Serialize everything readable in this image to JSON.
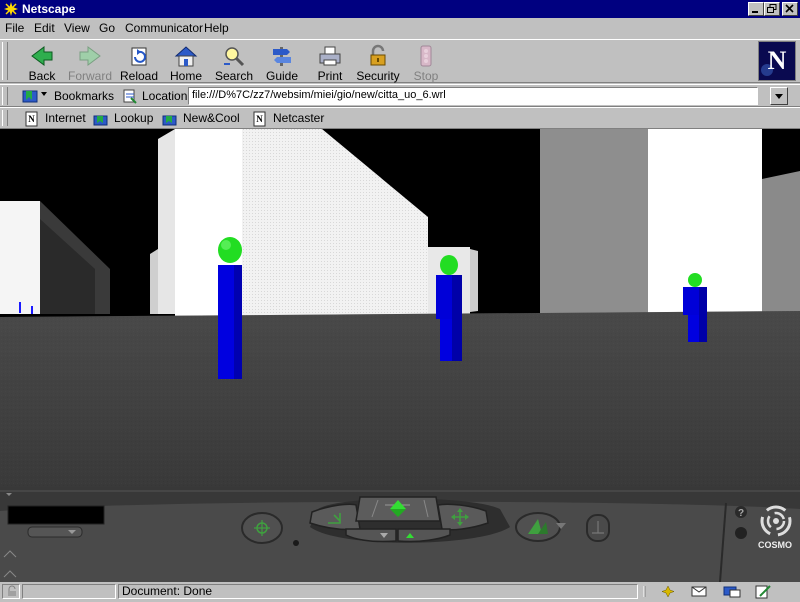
{
  "window": {
    "title": "Netscape"
  },
  "menu": {
    "items": [
      "File",
      "Edit",
      "View",
      "Go",
      "Communicator",
      "Help"
    ]
  },
  "toolbar": {
    "back": "Back",
    "forward": "Forward",
    "reload": "Reload",
    "home": "Home",
    "search": "Search",
    "guide": "Guide",
    "print": "Print",
    "security": "Security",
    "stop": "Stop"
  },
  "location": {
    "bookmarks_label": "Bookmarks",
    "location_label": "Location:",
    "url": "file:///D%7C/zz7/websim/miei/gio/new/citta_uo_6.wrl"
  },
  "personal_toolbar": {
    "items": [
      "Internet",
      "Lookup",
      "New&Cool",
      "Netcaster"
    ]
  },
  "viewer": {
    "brand": "COSMO",
    "colors": {
      "sky": "#000000",
      "ground": "#3c3c3c",
      "avatar_body": "#0000e6",
      "avatar_head": "#22dd22"
    }
  },
  "status": {
    "text": "Document: Done"
  },
  "icons": [
    "netscape-window-icon",
    "back-icon",
    "forward-icon",
    "reload-icon",
    "home-icon",
    "search-icon",
    "guide-icon",
    "print-icon",
    "security-icon",
    "stop-icon",
    "netscape-n-logo",
    "bookmarks-icon",
    "location-icon",
    "dropdown-arrow-icon",
    "bookmark-doc-icon",
    "cosmo-swirl-icon"
  ]
}
